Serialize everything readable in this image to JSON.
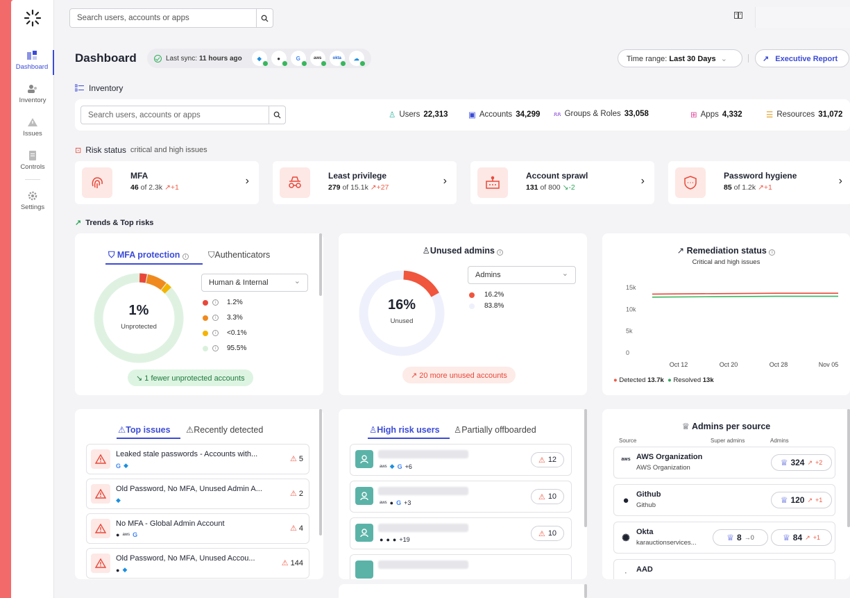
{
  "topbar": {
    "search_placeholder": "Search users, accounts or apps",
    "book_icon": "book-icon"
  },
  "sidebar": {
    "items": [
      {
        "label": "Dashboard",
        "icon": "dashboard-icon",
        "active": true
      },
      {
        "label": "Inventory",
        "icon": "users-icon"
      },
      {
        "label": "Issues",
        "icon": "warning-icon"
      },
      {
        "label": "Controls",
        "icon": "document-icon"
      },
      {
        "label": "Settings",
        "icon": "gear-icon"
      }
    ]
  },
  "header": {
    "title": "Dashboard",
    "sync_label": "Last sync:",
    "sync_value": "11 hours ago",
    "time_range_label": "Time range:",
    "time_range_value": "Last 30 Days",
    "executive_report": "Executive Report"
  },
  "inventory": {
    "section_label": "Inventory",
    "search_placeholder": "Search users, accounts or apps",
    "stats": [
      {
        "label": "Users",
        "value": "22,313"
      },
      {
        "label": "Accounts",
        "value": "34,299"
      },
      {
        "label": "Groups & Roles",
        "value": "33,058"
      },
      {
        "label": "Apps",
        "value": "4,332"
      },
      {
        "label": "Resources",
        "value": "31,072"
      }
    ]
  },
  "risk": {
    "section_label": "Risk status",
    "section_sub": "critical and high issues",
    "cards": [
      {
        "title": "MFA",
        "count": "46",
        "of": "of 2.3k",
        "delta": "+1",
        "trend": "up"
      },
      {
        "title": "Least privilege",
        "count": "279",
        "of": "of 15.1k",
        "delta": "+27",
        "trend": "up"
      },
      {
        "title": "Account sprawl",
        "count": "131",
        "of": "of 800",
        "delta": "-2",
        "trend": "down"
      },
      {
        "title": "Password hygiene",
        "count": "85",
        "of": "of 1.2k",
        "delta": "+1",
        "trend": "up"
      }
    ]
  },
  "trends": {
    "section_label": "Trends & Top risks",
    "mfa": {
      "tab_active": "MFA protection",
      "tab_other": "Authenticators",
      "filter": "Human & Internal",
      "center_value": "1%",
      "center_label": "Unprotected",
      "legend": [
        {
          "value": "1.2%",
          "color": "#e8483a",
          "fraction": 0.012
        },
        {
          "value": "3.3%",
          "color": "#f08a1e",
          "fraction": 0.033
        },
        {
          "value": "<0.1%",
          "color": "#f5b400",
          "fraction": 0.001
        },
        {
          "value": "95.5%",
          "color": "#d9f1dc",
          "fraction": 0.955
        }
      ],
      "pill": "1 fewer unprotected accounts"
    },
    "unused_admins": {
      "title": "Unused admins",
      "filter": "Admins",
      "center_value": "16%",
      "center_label": "Unused",
      "legend": [
        {
          "value": "16.2%",
          "color": "#f0553d",
          "fraction": 0.162
        },
        {
          "value": "83.8%",
          "color": "#eef0fb",
          "fraction": 0.838
        }
      ],
      "pill": "20 more unused accounts"
    },
    "remediation": {
      "title": "Remediation status",
      "subtitle": "Critical and high issues",
      "legend_detected": "Detected",
      "legend_detected_value": "13.7k",
      "legend_resolved": "Resolved",
      "legend_resolved_value": "13k"
    }
  },
  "chart_data": {
    "type": "line",
    "title": "Remediation status",
    "subtitle": "Critical and high issues",
    "x_ticks": [
      "Oct 12",
      "Oct 20",
      "Oct 28",
      "Nov 05"
    ],
    "y_ticks": [
      "0",
      "5k",
      "10k",
      "15k"
    ],
    "ylim": [
      0,
      15000
    ],
    "series": [
      {
        "name": "Detected",
        "color": "#e8483a",
        "values": [
          13500,
          13600,
          13700,
          13700
        ]
      },
      {
        "name": "Resolved",
        "color": "#37b75c",
        "values": [
          12800,
          12900,
          13000,
          13000
        ]
      }
    ]
  },
  "top_issues": {
    "tab_active": "Top issues",
    "tab_other": "Recently detected",
    "rows": [
      {
        "text": "Leaked stale passwords - Accounts with...",
        "count": "5"
      },
      {
        "text": "Old Password, No MFA, Unused Admin A...",
        "count": "2"
      },
      {
        "text": "No MFA - Global Admin Account",
        "count": "4"
      },
      {
        "text": "Old Password, No MFA, Unused Accou...",
        "count": "144"
      }
    ]
  },
  "high_risk": {
    "tab_active": "High risk users",
    "tab_other": "Partially offboarded",
    "rows": [
      {
        "extra": "+6",
        "score": "12"
      },
      {
        "extra": "+3",
        "score": "10"
      },
      {
        "extra": "+19",
        "score": "10"
      }
    ]
  },
  "admins": {
    "title": "Admins per source",
    "col_source": "Source",
    "col_super": "Super admins",
    "col_admins": "Admins",
    "rows": [
      {
        "name": "AWS Organization",
        "sub": "AWS Organization",
        "admins": "324",
        "delta": "+2"
      },
      {
        "name": "Github",
        "sub": "Github",
        "admins": "120",
        "delta": "+1"
      },
      {
        "name": "Okta",
        "sub": "karauctionservices...",
        "super": "8",
        "super_delta": "→0",
        "admins": "84",
        "delta": "+1"
      },
      {
        "name": "AAD"
      }
    ]
  }
}
